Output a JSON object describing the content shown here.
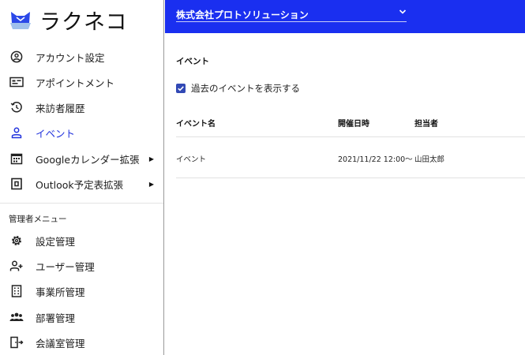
{
  "app": {
    "name": "ラクネコ",
    "accent": "#1a2ff0",
    "active_color": "#2233dd"
  },
  "header": {
    "company": "株式会社プロトソリューション"
  },
  "sidebar": {
    "items": [
      {
        "label": "アカウント設定",
        "icon": "account-circle-icon"
      },
      {
        "label": "アポイントメント",
        "icon": "id-card-icon"
      },
      {
        "label": "来訪者履歴",
        "icon": "history-icon"
      },
      {
        "label": "イベント",
        "icon": "event-person-icon",
        "active": true
      },
      {
        "label": "Googleカレンダー拡張",
        "icon": "calendar-icon",
        "has_submenu": true
      },
      {
        "label": "Outlook予定表拡張",
        "icon": "outlook-icon",
        "has_submenu": true
      }
    ],
    "admin_label": "管理者メニュー",
    "admin_items": [
      {
        "label": "設定管理",
        "icon": "gear-icon"
      },
      {
        "label": "ユーザー管理",
        "icon": "add-user-icon"
      },
      {
        "label": "事業所管理",
        "icon": "building-icon"
      },
      {
        "label": "部署管理",
        "icon": "group-icon"
      },
      {
        "label": "会議室管理",
        "icon": "meeting-room-icon"
      }
    ]
  },
  "main": {
    "title": "イベント",
    "show_past_label": "過去のイベントを表示する",
    "show_past_checked": true,
    "table": {
      "columns": [
        "イベント名",
        "開催日時",
        "担当者"
      ],
      "rows": [
        [
          "イベント",
          "2021/11/22 12:00〜",
          "山田太郎"
        ]
      ]
    }
  }
}
